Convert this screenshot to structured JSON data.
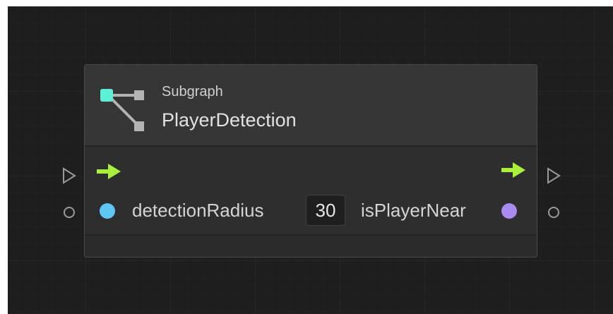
{
  "node": {
    "kind_label": "Subgraph",
    "title": "PlayerDetection",
    "icon": "subgraph-icon"
  },
  "flow": {
    "input_icon": "flow-arrow-icon",
    "output_icon": "flow-arrow-icon",
    "arrow_color": "#a8f03c"
  },
  "ports": {
    "input": {
      "label": "detectionRadius",
      "value": "30",
      "color": "#5ec8f5"
    },
    "output": {
      "label": "isPlayerNear",
      "color": "#a98af0"
    }
  },
  "colors": {
    "canvas_background": "#1e1e1e",
    "node_header": "#363636",
    "node_body": "#2e2e2e",
    "icon_accent": "#5ff0d8"
  }
}
